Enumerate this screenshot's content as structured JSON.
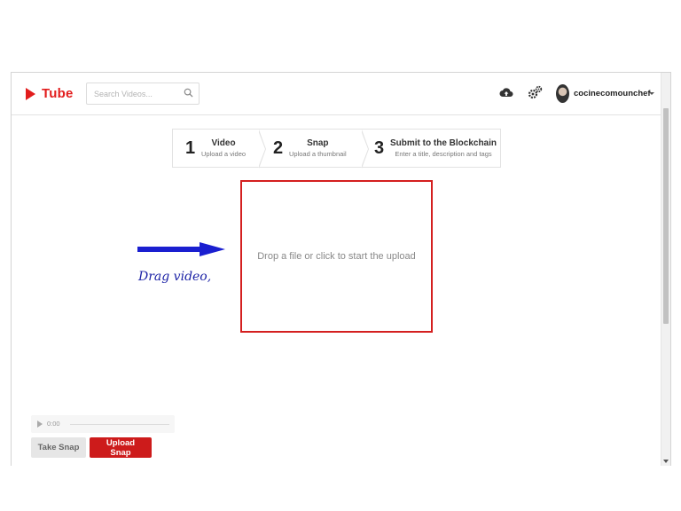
{
  "header": {
    "logo_text": "Tube",
    "search_placeholder": "Search Videos...",
    "username": "cocinecomounchef",
    "icons": [
      "play-logo-icon",
      "search-icon",
      "cloud-upload-icon",
      "gears-icon",
      "avatar",
      "chevron-down-icon"
    ]
  },
  "steps": [
    {
      "number": "1",
      "title": "Video",
      "subtitle": "Upload a video"
    },
    {
      "number": "2",
      "title": "Snap",
      "subtitle": "Upload a thumbnail"
    },
    {
      "number": "3",
      "title": "Submit to the Blockchain",
      "subtitle": "Enter a title, description and tags"
    }
  ],
  "dropzone": {
    "text": "Drop a file or click to start the upload"
  },
  "annotation": {
    "text": "Drag video,",
    "color": "#1c22a6"
  },
  "audio": {
    "time": "0:00"
  },
  "buttons": {
    "take_snap": "Take Snap",
    "upload_snap": "Upload Snap"
  },
  "colors": {
    "brand": "#e21d1d",
    "dropzone_border": "#d41f1f",
    "upload_button": "#cd1b1b",
    "arrow": "#1a1fd0"
  }
}
